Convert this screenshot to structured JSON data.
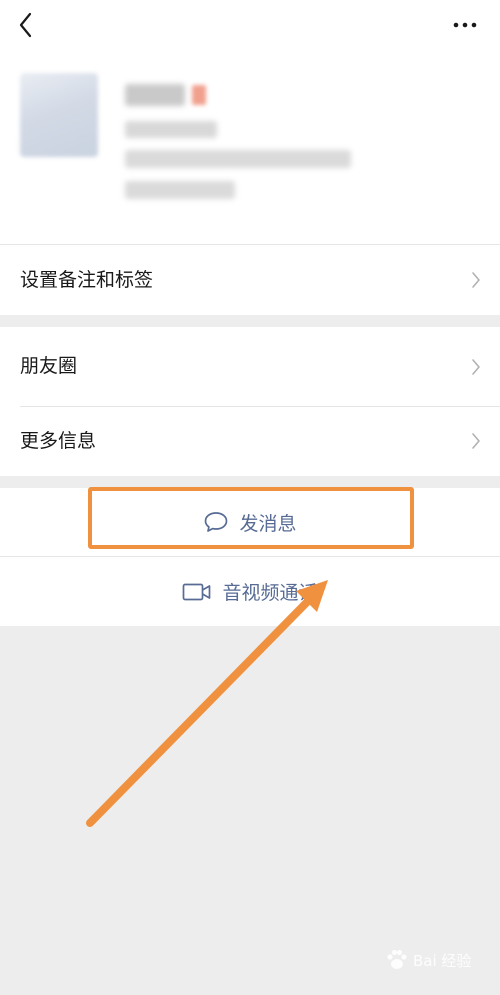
{
  "header": {
    "back_icon": "chevron-left-icon",
    "more_icon": "more-dots-icon"
  },
  "menu": {
    "remark_label": "设置备注和标签",
    "moments_label": "朋友圈",
    "more_info_label": "更多信息"
  },
  "actions": {
    "send_message_label": "发消息",
    "send_message_icon": "chat-bubble-icon",
    "av_call_label": "音视频通话",
    "av_call_icon": "video-camera-icon"
  },
  "annotation": {
    "highlight_color": "#f0913f",
    "arrow_color": "#f0913f"
  },
  "watermark": {
    "text": "Bai 经验"
  }
}
